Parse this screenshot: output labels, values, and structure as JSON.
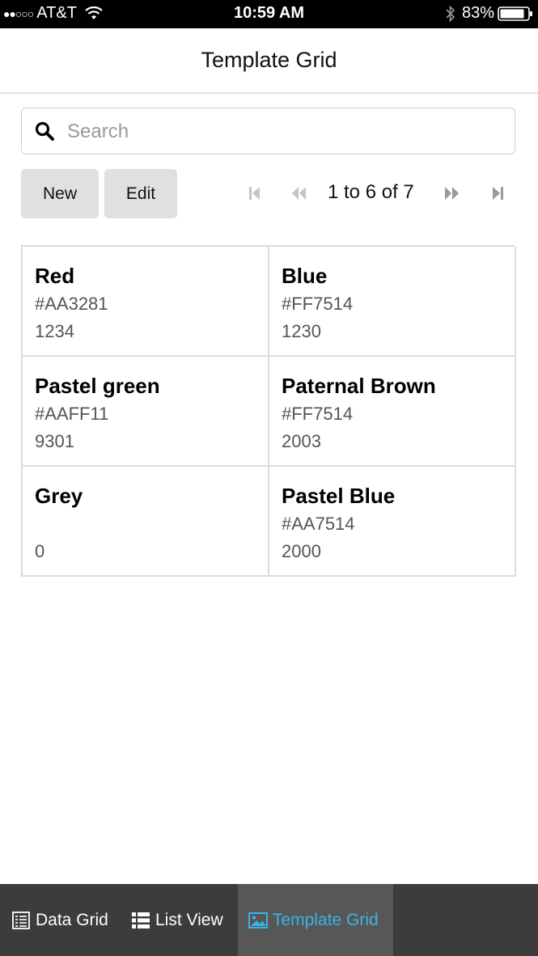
{
  "status_bar": {
    "signal": "●●○○○",
    "carrier": "AT&T",
    "time": "10:59 AM",
    "battery": "83%"
  },
  "header": {
    "title": "Template Grid"
  },
  "search": {
    "placeholder": "Search",
    "value": ""
  },
  "toolbar": {
    "new_label": "New",
    "edit_label": "Edit"
  },
  "pager": {
    "text": "1 to 6 of 7"
  },
  "grid": {
    "items": [
      {
        "name": "Red",
        "hex": "#AA3281",
        "number": "1234"
      },
      {
        "name": "Blue",
        "hex": "#FF7514",
        "number": "1230"
      },
      {
        "name": "Pastel green",
        "hex": "#AAFF11",
        "number": "9301"
      },
      {
        "name": "Paternal Brown",
        "hex": "#FF7514",
        "number": "2003"
      },
      {
        "name": "Grey",
        "hex": "",
        "number": "0"
      },
      {
        "name": "Pastel Blue",
        "hex": "#AA7514",
        "number": "2000"
      }
    ]
  },
  "tab_bar": {
    "tabs": [
      {
        "label": "Data Grid",
        "icon": "data-grid-icon"
      },
      {
        "label": "List View",
        "icon": "list-view-icon"
      },
      {
        "label": "Template Grid",
        "icon": "image-icon",
        "active": true
      }
    ]
  },
  "colors": {
    "active_tab_text": "#3bb3e6",
    "tab_bar_bg": "#3c3c3c",
    "active_tab_bg": "#575757",
    "button_bg": "#e0e0e0"
  }
}
